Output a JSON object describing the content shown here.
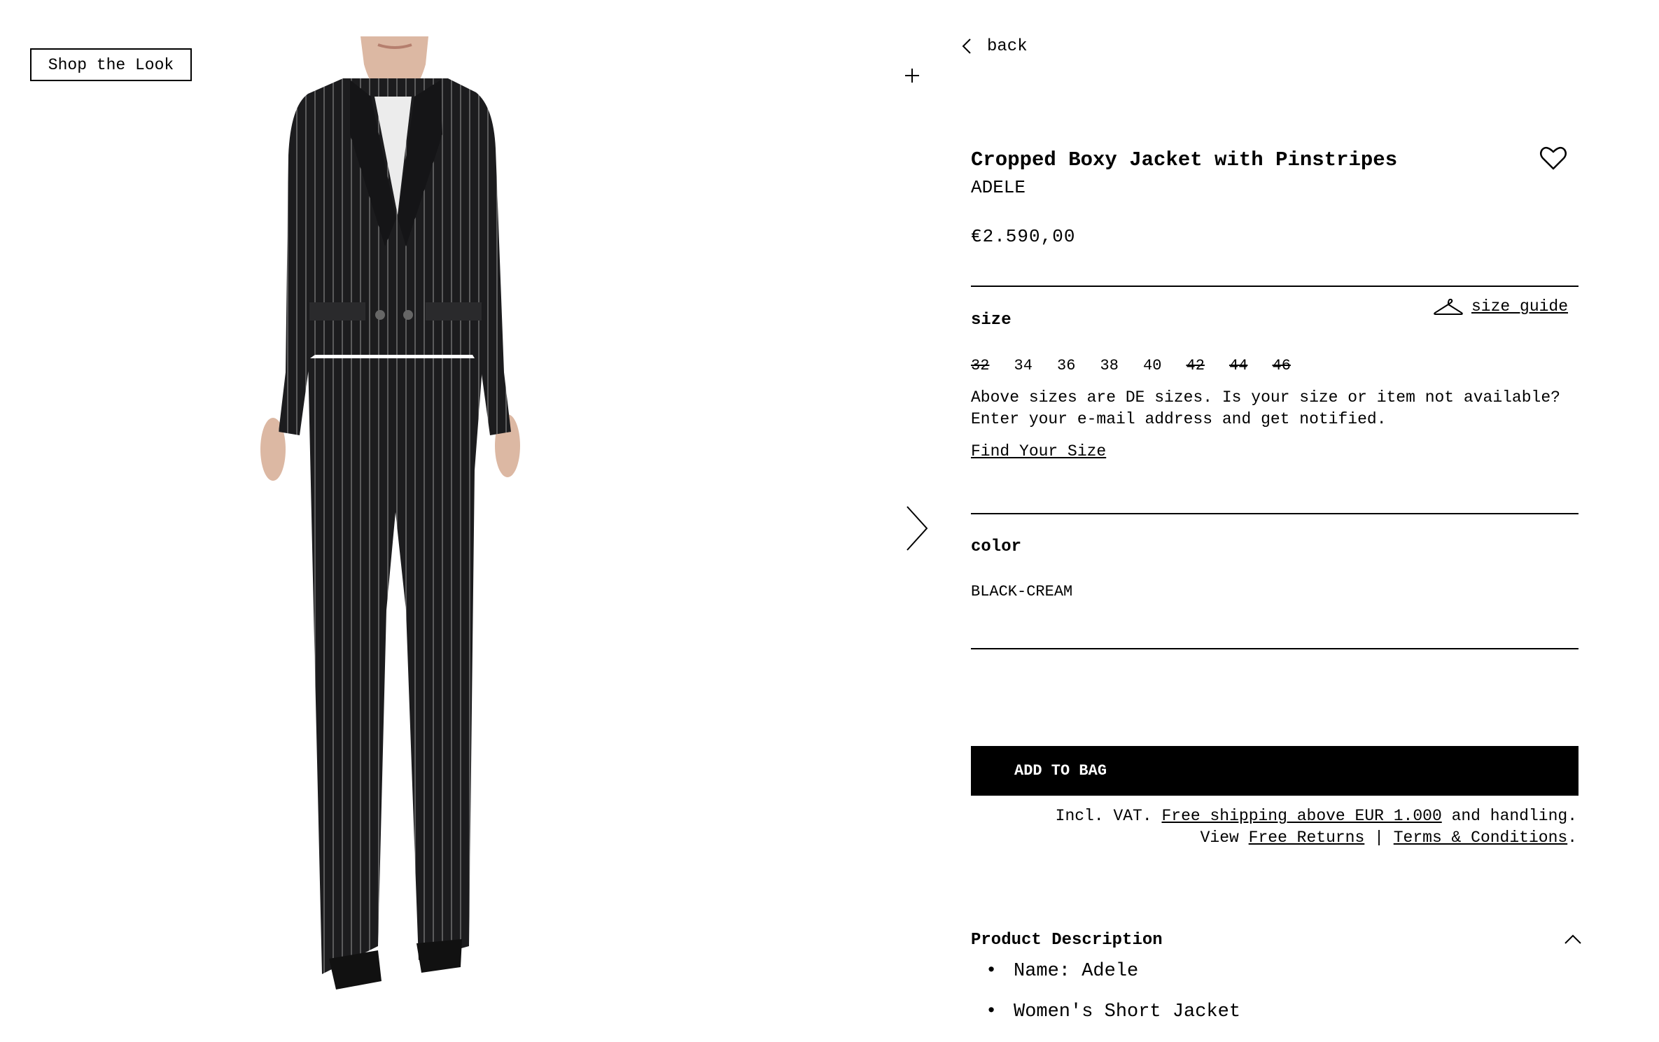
{
  "gallery": {
    "shop_the_look_label": "Shop the Look"
  },
  "nav": {
    "back_label": "back"
  },
  "product": {
    "title": "Cropped Boxy Jacket with Pinstripes",
    "brand": "ADELE",
    "price": "€2.590,00"
  },
  "size": {
    "label": "size",
    "guide_label": "size guide",
    "options": [
      {
        "value": "32",
        "available": false
      },
      {
        "value": "34",
        "available": true
      },
      {
        "value": "36",
        "available": true
      },
      {
        "value": "38",
        "available": true
      },
      {
        "value": "40",
        "available": true
      },
      {
        "value": "42",
        "available": false
      },
      {
        "value": "44",
        "available": false
      },
      {
        "value": "46",
        "available": false
      }
    ],
    "note": "Above sizes are DE sizes. Is your size or item not available? Enter your e-mail address and get notified.",
    "find_your_size": "Find Your Size"
  },
  "color": {
    "label": "color",
    "value": "BLACK-CREAM"
  },
  "cart": {
    "add_to_bag": "ADD TO BAG",
    "incl_vat": "Incl. VAT.",
    "free_shipping": "Free shipping above EUR 1.000",
    "and_handling": "and handling.",
    "view": "View",
    "free_returns": "Free Returns",
    "separator": "|",
    "terms": "Terms & Conditions",
    "period": "."
  },
  "description": {
    "title": "Product Description",
    "bullets": [
      "Name: Adele",
      "Women's Short Jacket"
    ]
  },
  "icons": {
    "back": "chevron-left-icon",
    "plus": "plus-icon",
    "next": "chevron-right-icon",
    "wishlist": "heart-icon",
    "size_guide": "hanger-icon",
    "collapse": "chevron-up-icon"
  },
  "colors": {
    "primary": "#000000",
    "background": "#ffffff",
    "suit": "#1c1c1e",
    "pinstripe": "#bfbfbf"
  }
}
